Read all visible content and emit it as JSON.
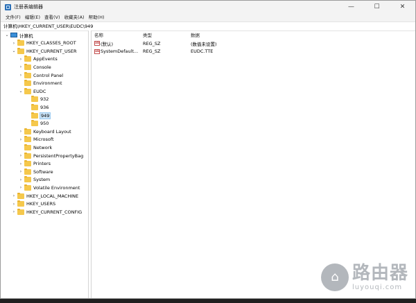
{
  "window": {
    "title": "注册表编辑器"
  },
  "window_controls": {
    "minimize": "—",
    "maximize": "☐",
    "close": "✕"
  },
  "menu": [
    "文件(F)",
    "编辑(E)",
    "查看(V)",
    "收藏夹(A)",
    "帮助(H)"
  ],
  "address": "计算机\\HKEY_CURRENT_USER\\EUDC\\949",
  "tree": [
    {
      "label": "计算机",
      "toggle": "v",
      "level": 0,
      "icon": "computer-icon"
    },
    {
      "label": "HKEY_CLASSES_ROOT",
      "toggle": ">",
      "level": 1
    },
    {
      "label": "HKEY_CURRENT_USER",
      "toggle": "v",
      "level": 1
    },
    {
      "label": "AppEvents",
      "toggle": ">",
      "level": 2
    },
    {
      "label": "Console",
      "toggle": ">",
      "level": 2
    },
    {
      "label": "Control Panel",
      "toggle": ">",
      "level": 2
    },
    {
      "label": "Environment",
      "toggle": "",
      "level": 2
    },
    {
      "label": "EUDC",
      "toggle": "v",
      "level": 2
    },
    {
      "label": "932",
      "toggle": "",
      "level": 3
    },
    {
      "label": "936",
      "toggle": "",
      "level": 3
    },
    {
      "label": "949",
      "toggle": "",
      "level": 3,
      "selected": true
    },
    {
      "label": "950",
      "toggle": "",
      "level": 3
    },
    {
      "label": "Keyboard Layout",
      "toggle": ">",
      "level": 2
    },
    {
      "label": "Microsoft",
      "toggle": ">",
      "level": 2
    },
    {
      "label": "Network",
      "toggle": "",
      "level": 2
    },
    {
      "label": "PersistentPropertyBag",
      "toggle": ">",
      "level": 2
    },
    {
      "label": "Printers",
      "toggle": ">",
      "level": 2
    },
    {
      "label": "Software",
      "toggle": ">",
      "level": 2
    },
    {
      "label": "System",
      "toggle": ">",
      "level": 2
    },
    {
      "label": "Volatile Environment",
      "toggle": ">",
      "level": 2
    },
    {
      "label": "HKEY_LOCAL_MACHINE",
      "toggle": ">",
      "level": 1
    },
    {
      "label": "HKEY_USERS",
      "toggle": ">",
      "level": 1
    },
    {
      "label": "HKEY_CURRENT_CONFIG",
      "toggle": ">",
      "level": 1
    }
  ],
  "columns": {
    "name": "名称",
    "type": "类型",
    "data": "数据"
  },
  "values": [
    {
      "icon": "ab",
      "name": "(默认)",
      "type": "REG_SZ",
      "data": "(数值未设置)"
    },
    {
      "icon": "ab",
      "name": "SystemDefault...",
      "type": "REG_SZ",
      "data": "EUDC.TTE"
    }
  ],
  "watermark": {
    "logo": "⌂",
    "text": "路由器",
    "url": "luyouqi.com"
  }
}
